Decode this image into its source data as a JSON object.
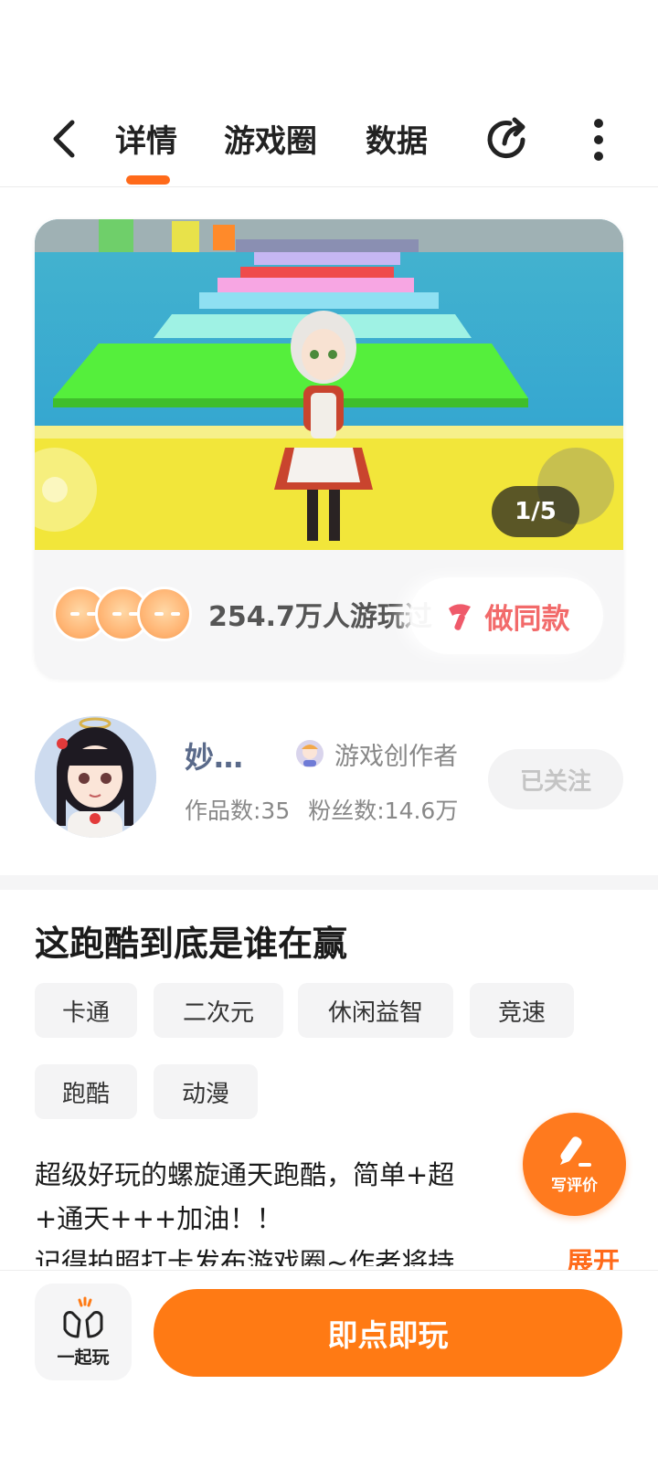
{
  "nav": {
    "tabs": [
      {
        "label": "详情",
        "active": true
      },
      {
        "label": "游戏圈",
        "active": false
      },
      {
        "label": "数据",
        "active": false
      }
    ],
    "icons": {
      "back": "chevron-left-icon",
      "share": "share-icon",
      "more": "more-vertical-icon"
    }
  },
  "hero": {
    "image_counter": "1/5",
    "players_text": "254.7万人游玩过",
    "make_same_label": "做同款"
  },
  "author": {
    "name": "妙…",
    "badge_label": "游戏创作者",
    "works_label": "作品数:35",
    "fans_label": "粉丝数:14.6万",
    "follow_label": "已关注"
  },
  "game": {
    "title": "这跑酷到底是谁在赢",
    "tags": [
      "卡通",
      "二次元",
      "休闲益智",
      "竞速",
      "跑酷",
      "动漫"
    ],
    "description_lines": [
      "超级好玩的螺旋通天跑酷，简单+超",
      "+通天+++加油！！",
      "记得拍照打卡发布游戏圈~作者将持"
    ],
    "expand_label": "展开"
  },
  "fab": {
    "label": "写评价",
    "icon": "pencil-icon"
  },
  "bottom": {
    "together_label": "一起玩",
    "play_label": "即点即玩"
  },
  "colors": {
    "accent": "#ff7a14",
    "tab_indicator": "#ff6a1a",
    "same_button_text": "#f26a6a"
  }
}
